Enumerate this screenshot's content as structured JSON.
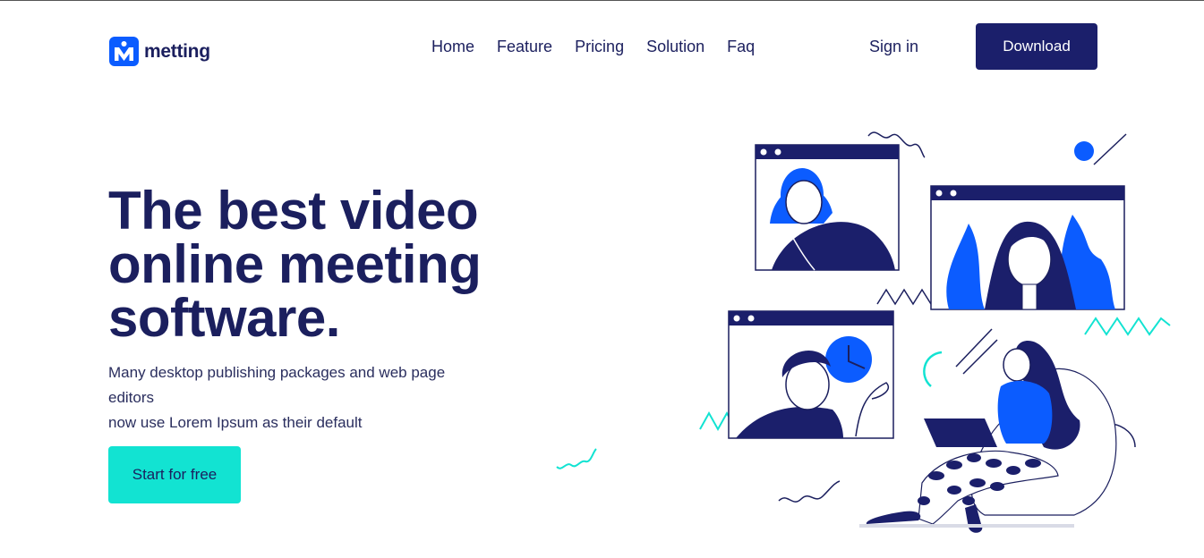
{
  "brand": {
    "name": "metting",
    "logo_letter": "M"
  },
  "nav": {
    "items": [
      {
        "label": "Home"
      },
      {
        "label": "Feature"
      },
      {
        "label": "Pricing"
      },
      {
        "label": "Solution"
      },
      {
        "label": "Faq"
      }
    ],
    "sign_in": "Sign in",
    "download": "Download"
  },
  "hero": {
    "title": "The best video online meeting software.",
    "subtitle_lines": [
      "Many desktop publishing packages and web page",
      "editors",
      "now use Lorem Ipsum as their default"
    ],
    "cta": "Start for free"
  },
  "colors": {
    "navy": "#1b1f5e",
    "primary_blue": "#0b5cff",
    "accent_teal": "#12e3d2",
    "button_dark": "#1b1f6b"
  }
}
